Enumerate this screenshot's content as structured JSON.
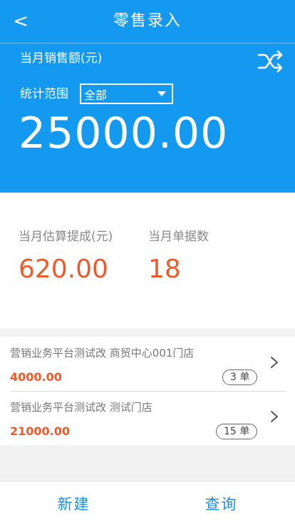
{
  "nav": {
    "back_glyph": "<",
    "title": "零售录入"
  },
  "summary": {
    "label": "当月销售额(元)",
    "range_label": "统计范围",
    "range_value": "全部",
    "amount": "25000.00"
  },
  "stats": {
    "commission_label": "当月估算提成(元)",
    "commission_value": "620.00",
    "docs_label": "当月单据数",
    "docs_value": "18"
  },
  "list": [
    {
      "name": "营销业务平台测试改    商贸中心001门店",
      "amount": "4000.00",
      "count": "3 单"
    },
    {
      "name": "营销业务平台测试改    测试门店",
      "amount": "21000.00",
      "count": "15 单"
    }
  ],
  "bottom": {
    "new_label": "新建",
    "query_label": "查询"
  },
  "colors": {
    "primary": "#1499f0",
    "accent": "#f05a2b",
    "link": "#1a8fe0"
  }
}
